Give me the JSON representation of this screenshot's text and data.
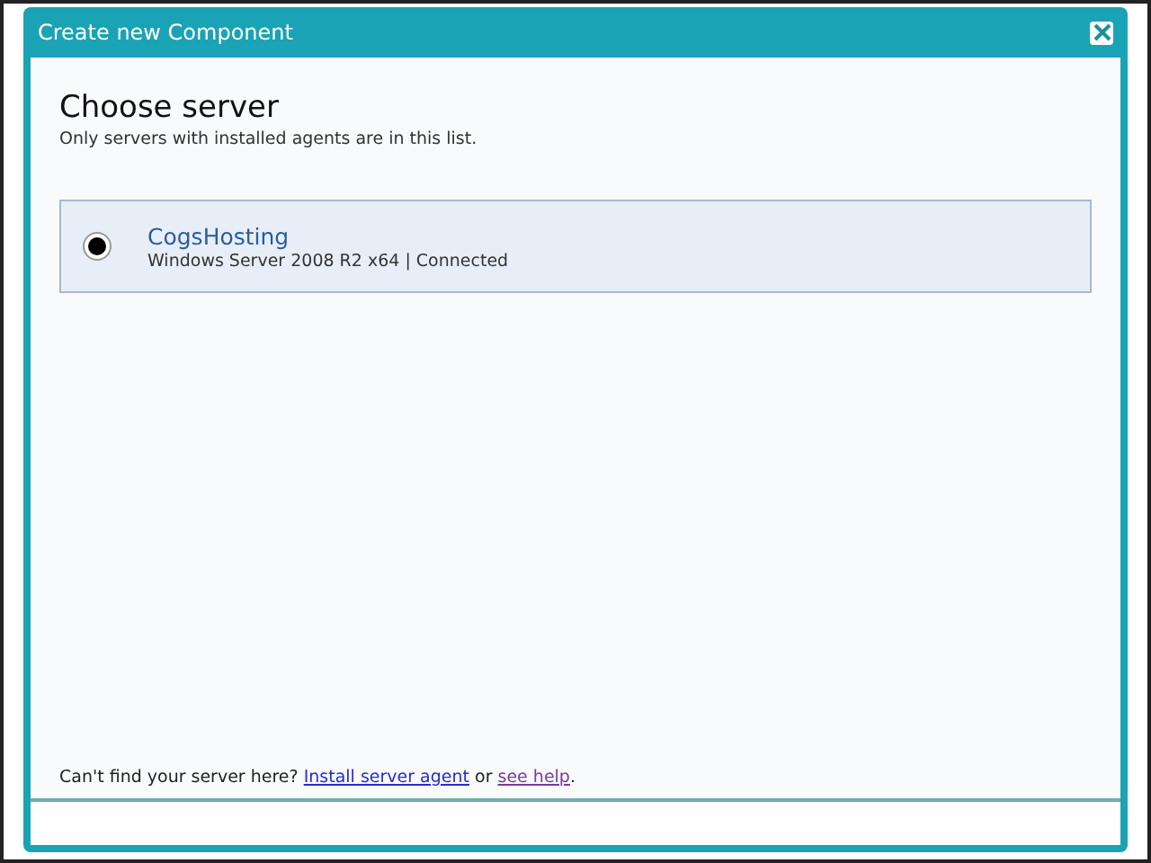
{
  "window": {
    "title": "Create new Component"
  },
  "heading": "Choose server",
  "subheading": "Only servers with installed agents are in this list.",
  "servers": [
    {
      "name": "CogsHosting",
      "details": "Windows Server 2008 R2 x64 | Connected",
      "selected": true
    }
  ],
  "footer": {
    "before": "Can't find your server here? ",
    "link1": "Install server agent",
    "middle": " or ",
    "link2": "see help",
    "after": "."
  }
}
